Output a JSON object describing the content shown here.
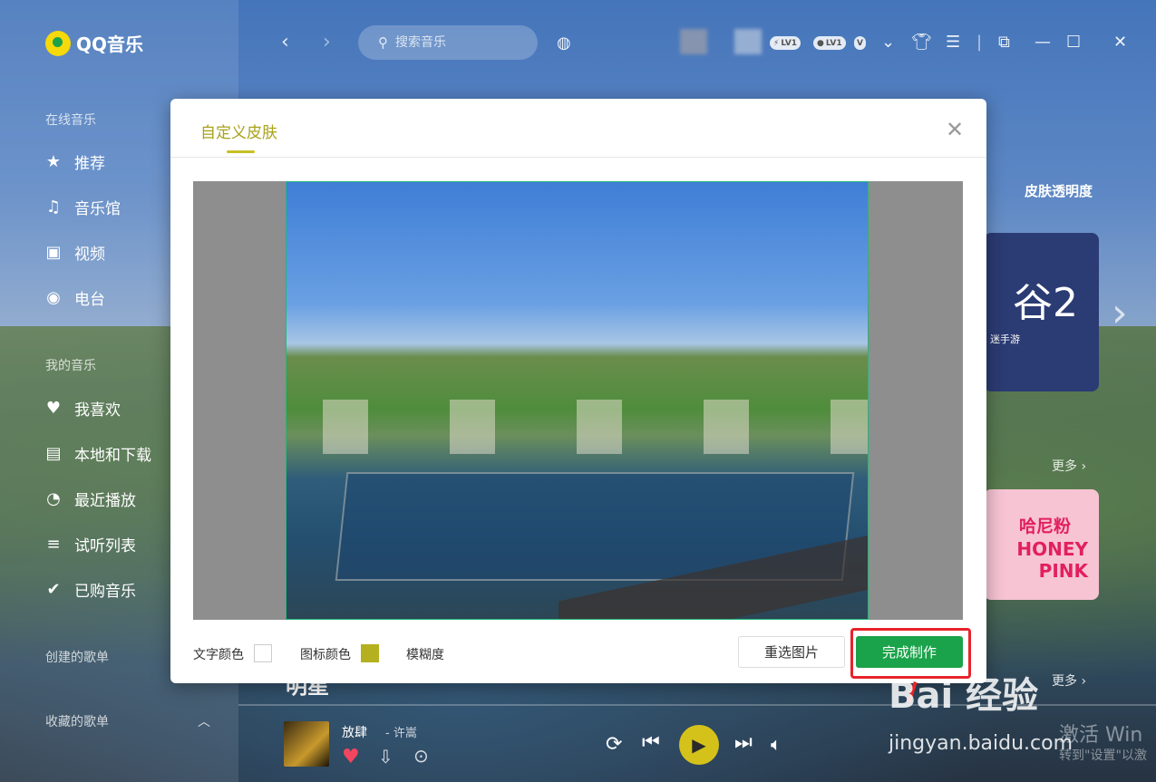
{
  "app": {
    "name": "QQ音乐"
  },
  "sidebar": {
    "online_title": "在线音乐",
    "online_items": [
      {
        "label": "推荐",
        "icon": "star-icon"
      },
      {
        "label": "音乐馆",
        "icon": "music-note-icon"
      },
      {
        "label": "视频",
        "icon": "video-icon"
      },
      {
        "label": "电台",
        "icon": "radio-icon"
      }
    ],
    "my_title": "我的音乐",
    "my_items": [
      {
        "label": "我喜欢",
        "icon": "heart-icon"
      },
      {
        "label": "本地和下载",
        "icon": "folder-icon"
      },
      {
        "label": "最近播放",
        "icon": "clock-icon"
      },
      {
        "label": "试听列表",
        "icon": "list-icon"
      },
      {
        "label": "已购音乐",
        "icon": "check-circle-icon"
      }
    ],
    "created_title": "创建的歌单",
    "collected_title": "收藏的歌单"
  },
  "topbar": {
    "search_placeholder": "搜索音乐",
    "badges": [
      "LV1",
      "LV1"
    ]
  },
  "background": {
    "skin_opacity": "皮肤透明度",
    "banner_num": "谷2",
    "banner_sub": "迷手游",
    "more1": "更多",
    "more2": "更多",
    "pink_cn": "哈尼粉",
    "pink_en": "HONEY PINK",
    "star_heading": "明星"
  },
  "player": {
    "song": "放肆",
    "artist": "- 许嵩"
  },
  "modal": {
    "tab": "自定义皮肤",
    "text_color_label": "文字颜色",
    "icon_color_label": "图标颜色",
    "blur_label": "模糊度",
    "text_color": "#ffffff",
    "icon_color": "#b5b01f",
    "reselect_label": "重选图片",
    "done_label": "完成制作"
  },
  "watermark": {
    "brand": "Bai 经验",
    "url": "jingyan.baidu.com",
    "activate": "激活 Win",
    "activate_sub": "转到\"设置\"以激"
  },
  "colors": {
    "accent_green": "#1aa34a",
    "tab_olive": "#a8a21a",
    "annotation_red": "#e8232a"
  }
}
